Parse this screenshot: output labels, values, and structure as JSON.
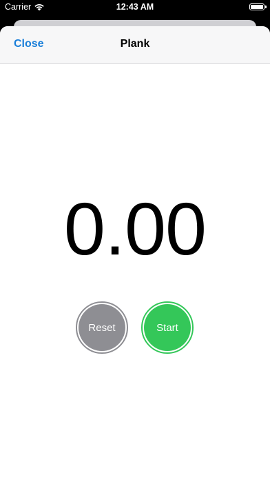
{
  "status_bar": {
    "carrier": "Carrier",
    "time": "12:43 AM",
    "wifi_icon": "wifi-icon",
    "battery_icon": "battery-icon"
  },
  "nav": {
    "close_label": "Close",
    "title": "Plank"
  },
  "timer": {
    "value": "0.00"
  },
  "controls": {
    "reset_label": "Reset",
    "start_label": "Start"
  },
  "colors": {
    "accent": "#1a7fd9",
    "reset": "#8e8e93",
    "start": "#34c759"
  }
}
